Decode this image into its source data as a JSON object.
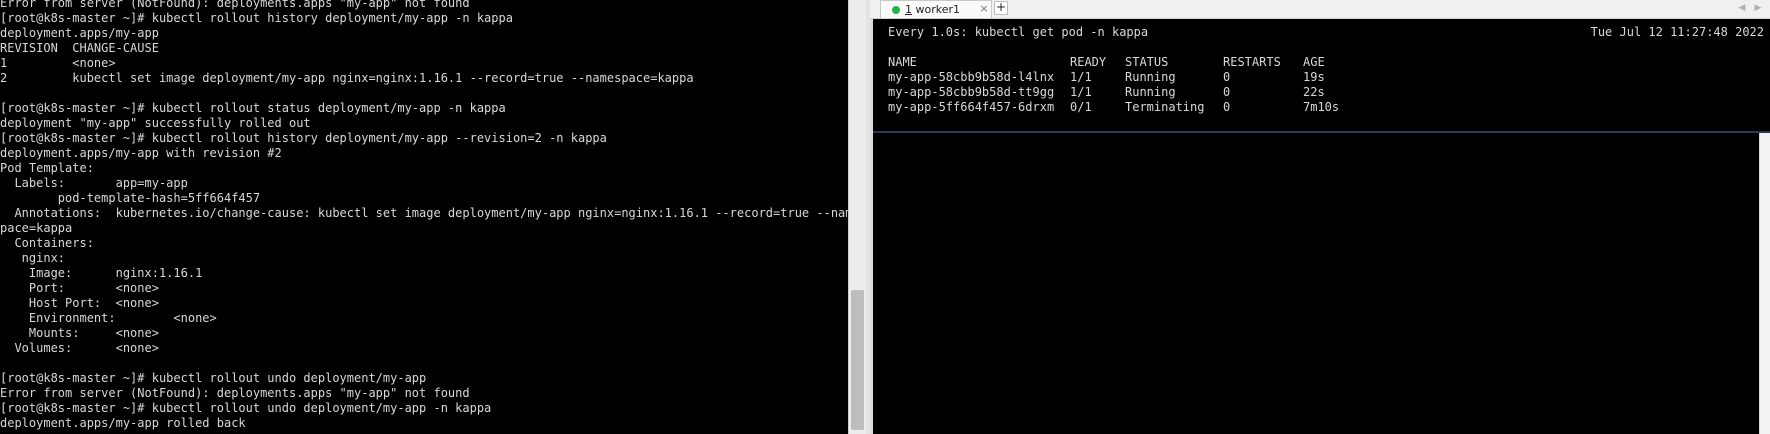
{
  "left_terminal": {
    "lines": [
      "Error from server (NotFound): deployments.apps \"my-app\" not found",
      "[root@k8s-master ~]# kubectl rollout history deployment/my-app -n kappa",
      "deployment.apps/my-app",
      "REVISION  CHANGE-CAUSE",
      "1         <none>",
      "2         kubectl set image deployment/my-app nginx=nginx:1.16.1 --record=true --namespace=kappa",
      "",
      "[root@k8s-master ~]# kubectl rollout status deployment/my-app -n kappa",
      "deployment \"my-app\" successfully rolled out",
      "[root@k8s-master ~]# kubectl rollout history deployment/my-app --revision=2 -n kappa",
      "deployment.apps/my-app with revision #2",
      "Pod Template:",
      "  Labels:       app=my-app",
      "        pod-template-hash=5ff664f457",
      "  Annotations:  kubernetes.io/change-cause: kubectl set image deployment/my-app nginx=nginx:1.16.1 --record=true --names",
      "pace=kappa",
      "  Containers:",
      "   nginx:",
      "    Image:      nginx:1.16.1",
      "    Port:       <none>",
      "    Host Port:  <none>",
      "    Environment:        <none>",
      "    Mounts:     <none>",
      "  Volumes:      <none>",
      "",
      "[root@k8s-master ~]# kubectl rollout undo deployment/my-app",
      "Error from server (NotFound): deployments.apps \"my-app\" not found",
      "[root@k8s-master ~]# kubectl rollout undo deployment/my-app -n kappa",
      "deployment.apps/my-app rolled back"
    ]
  },
  "tab_bar": {
    "tab_number": "1",
    "tab_name": " worker1",
    "close_glyph": "×",
    "new_tab_glyph": "+",
    "prev_glyph": "◀",
    "next_glyph": "▶"
  },
  "watch": {
    "command": "Every 1.0s: kubectl get pod -n kappa",
    "timestamp": "Tue Jul 12 11:27:48 2022",
    "columns": [
      "NAME",
      "READY",
      "STATUS",
      "RESTARTS",
      "AGE"
    ],
    "rows": [
      [
        "my-app-58cbb9b58d-l4lnx",
        "1/1",
        "Running",
        "0",
        "19s"
      ],
      [
        "my-app-58cbb9b58d-tt9gg",
        "1/1",
        "Running",
        "0",
        "22s"
      ],
      [
        "my-app-5ff664f457-6drxm",
        "0/1",
        "Terminating",
        "0",
        "7m10s"
      ]
    ]
  },
  "colors": {
    "terminal_bg": "#000000",
    "terminal_fg": "#d8d8d8",
    "tab_status_dot": "#21b24b"
  },
  "icons": {
    "tab_status": "status-dot-icon",
    "tab_close": "close-icon",
    "new_tab": "plus-icon",
    "tab_prev": "chevron-left-icon",
    "tab_next": "chevron-right-icon"
  }
}
